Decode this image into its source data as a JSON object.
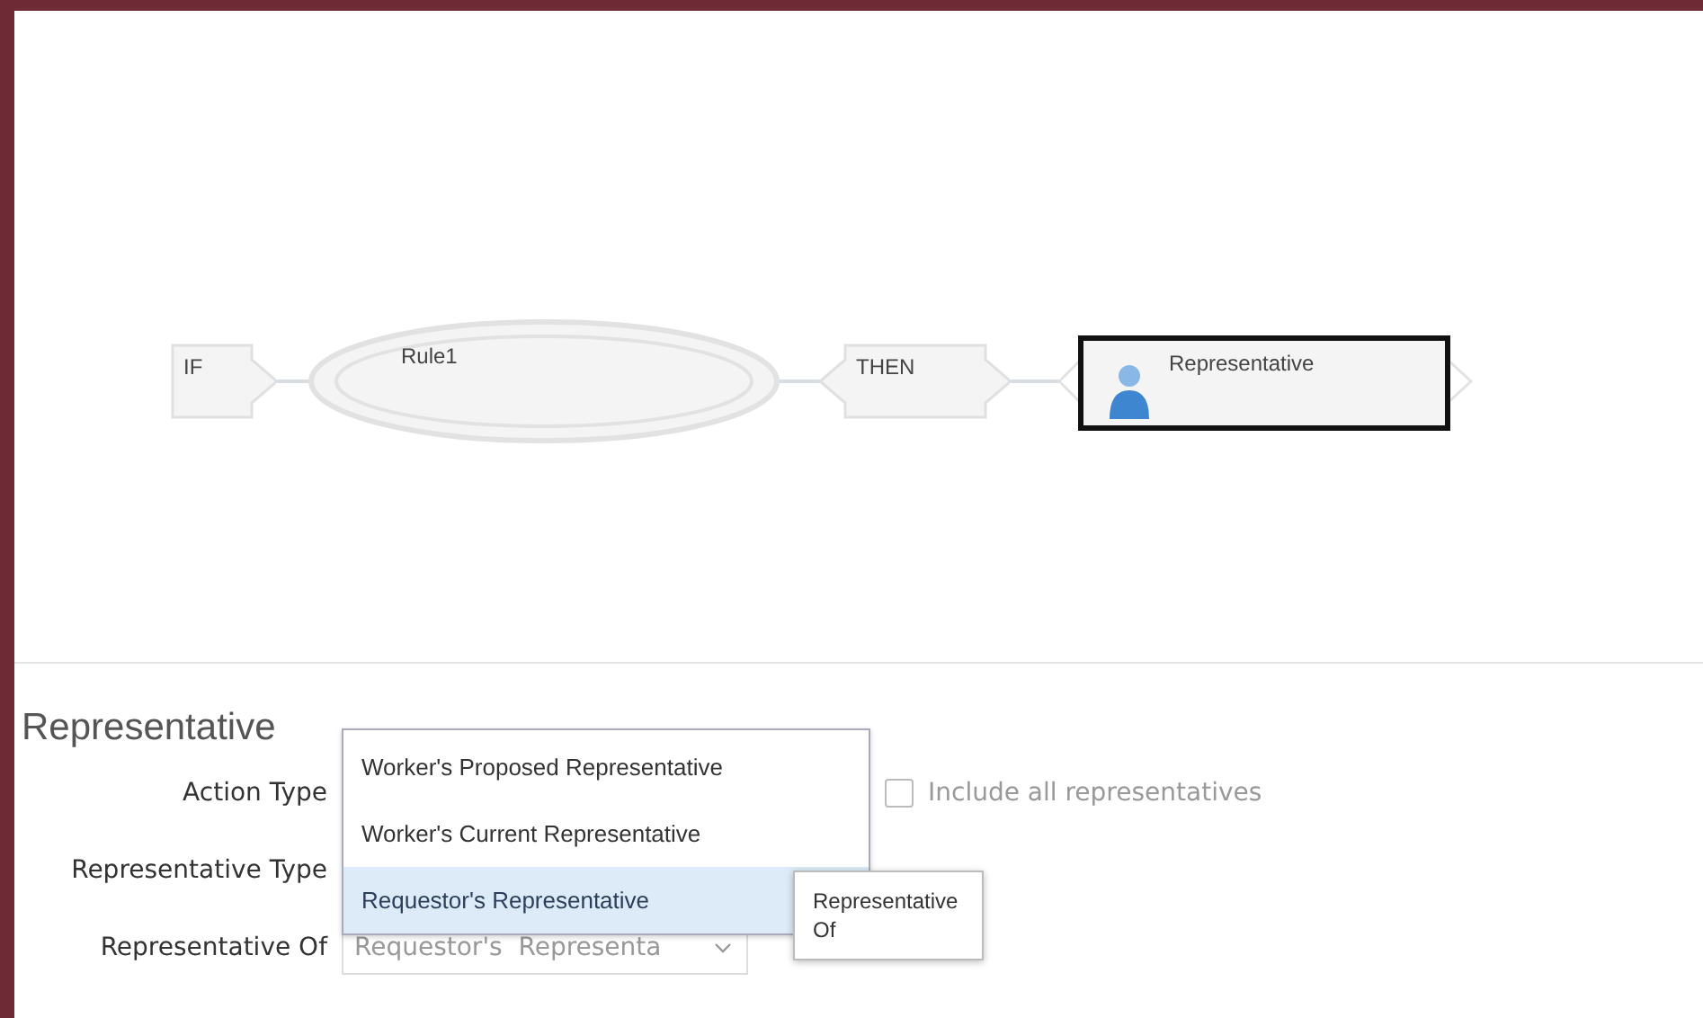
{
  "diagram": {
    "nodes": [
      {
        "kind": "if",
        "label": "IF",
        "selected": false
      },
      {
        "kind": "rule",
        "label": "Rule1",
        "selected": false
      },
      {
        "kind": "then",
        "label": "THEN",
        "selected": false
      },
      {
        "kind": "action",
        "label": "Representative",
        "selected": true
      }
    ]
  },
  "form": {
    "title": "Representative",
    "fields": [
      {
        "label": "Action Type"
      },
      {
        "label": "Representative Type"
      },
      {
        "label": "Representative Of",
        "value": "Requestor's  Representa"
      }
    ],
    "checkbox": {
      "label": "Include all representatives",
      "checked": false
    },
    "dropdown": {
      "options": [
        {
          "label": "Worker's Proposed Representative",
          "selected": false
        },
        {
          "label": "Worker's Current Representative",
          "selected": false
        },
        {
          "label": "Requestor's Representative",
          "selected": true
        }
      ]
    },
    "tooltip": "Representative Of"
  }
}
